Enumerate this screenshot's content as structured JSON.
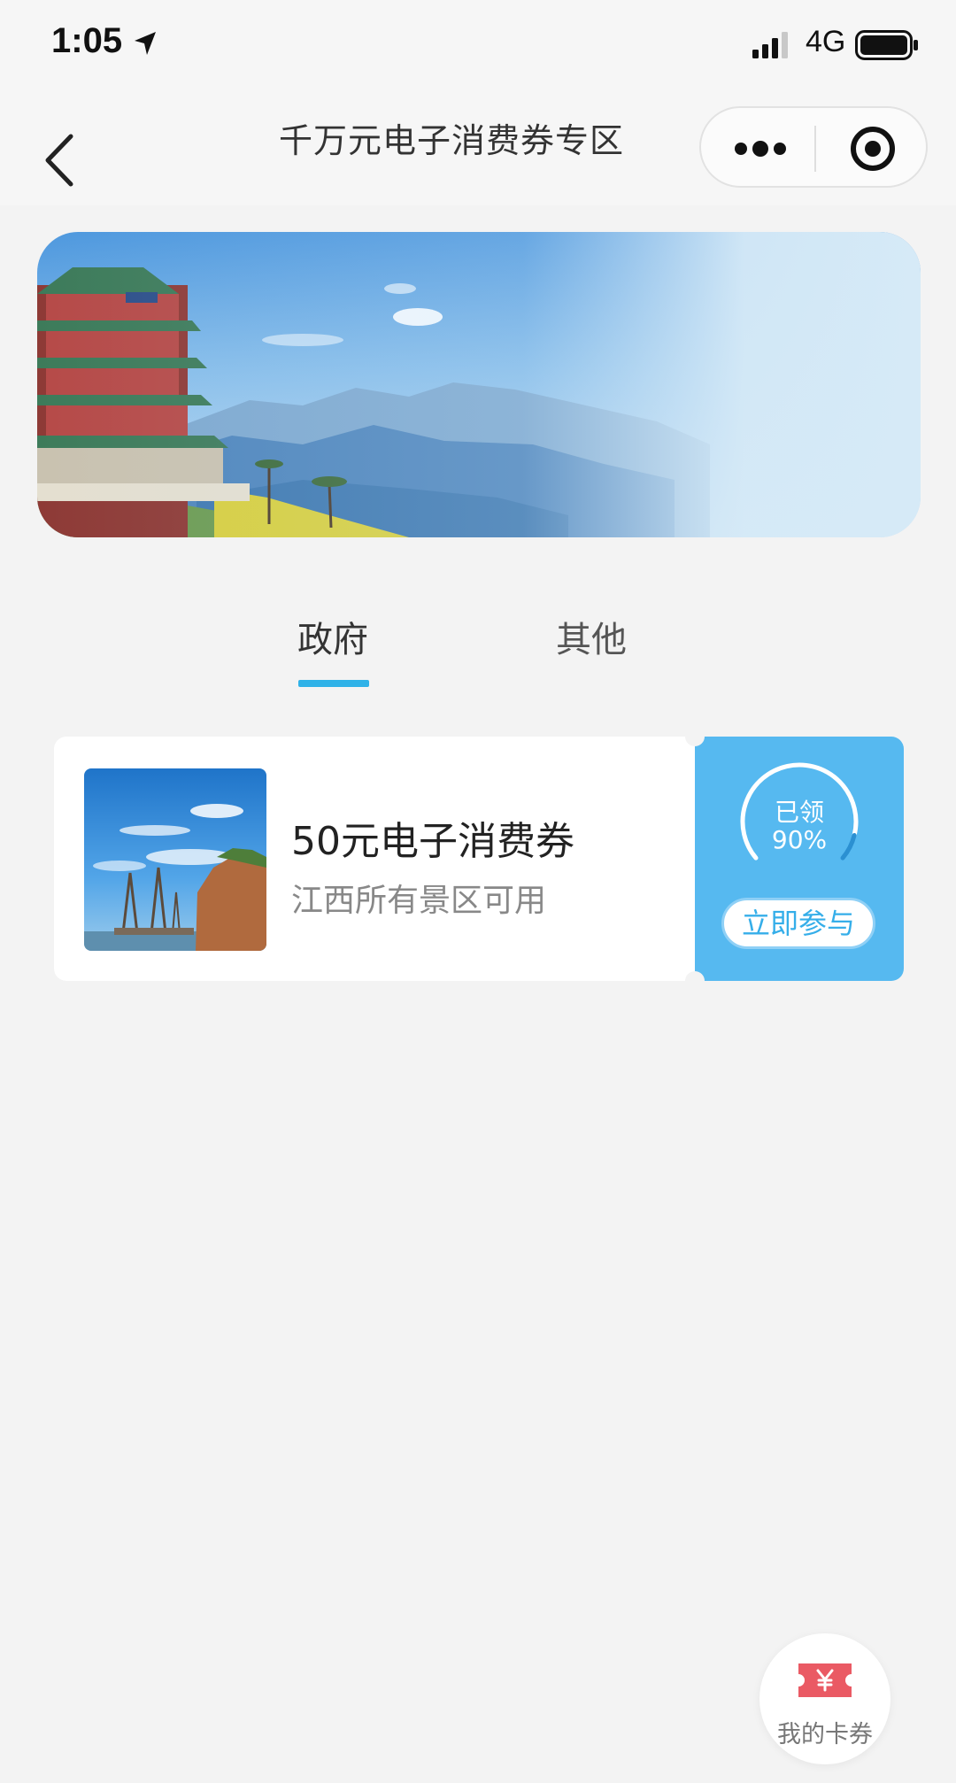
{
  "status_bar": {
    "time": "1:05",
    "network": "4G",
    "icons": [
      "location-arrow-icon",
      "signal-icon",
      "battery-icon"
    ]
  },
  "nav": {
    "title": "千万元电子消费券专区",
    "icons": [
      "back-icon",
      "more-dots-icon",
      "target-icon"
    ]
  },
  "tabs": [
    {
      "label": "政府",
      "active": true
    },
    {
      "label": "其他",
      "active": false
    }
  ],
  "coupon": {
    "title": "50元电子消费券",
    "description": "江西所有景区可用",
    "claimed_label": "已领",
    "claimed_percent": "90%",
    "claimed_fraction": 0.9,
    "action_label": "立即参与"
  },
  "floating": {
    "label": "我的卡券",
    "icon": "yen-ticket-icon"
  },
  "colors": {
    "accent": "#2fb2e8",
    "coupon_side": "#56b9f0",
    "ticket_red": "#ea5a64"
  }
}
